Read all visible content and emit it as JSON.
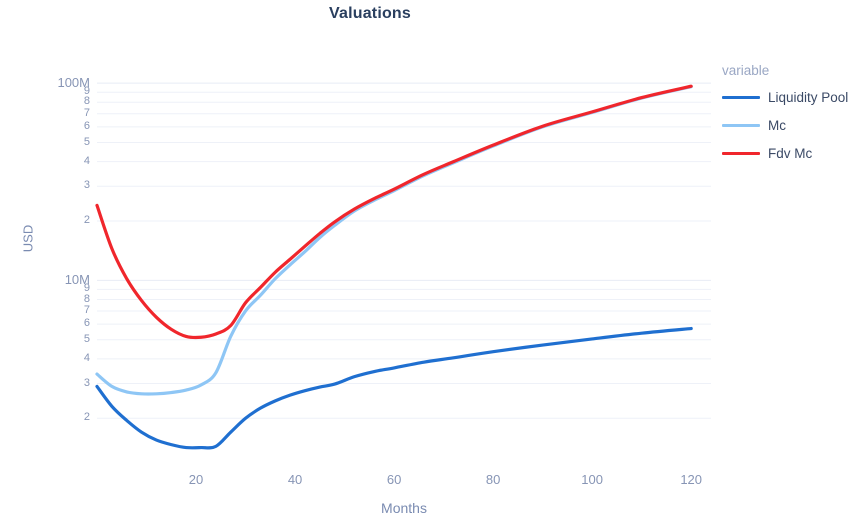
{
  "chart_data": {
    "type": "line",
    "title": "Valuations",
    "xlabel": "Months",
    "ylabel": "USD",
    "legend_title": "variable",
    "legend_position": "right",
    "grid": true,
    "yscale": "log",
    "ylim": [
      1200000,
      110000000
    ],
    "xlim": [
      0,
      124
    ],
    "xticks": [
      20,
      40,
      60,
      80,
      100,
      120
    ],
    "ytick_labels": [
      "100M",
      "9",
      "8",
      "7",
      "6",
      "5",
      "4",
      "3",
      "2",
      "10M",
      "9",
      "8",
      "7",
      "6",
      "5",
      "4",
      "3",
      "2"
    ],
    "ytick_values": [
      100000000,
      90000000,
      80000000,
      70000000,
      60000000,
      50000000,
      40000000,
      30000000,
      20000000,
      10000000,
      9000000,
      8000000,
      7000000,
      6000000,
      5000000,
      4000000,
      3000000,
      2000000
    ],
    "ytick_major": [
      "100M",
      "10M"
    ],
    "colors": {
      "liquidity_pool": "#1f6fd0",
      "mc": "#8ec6f5",
      "fdv_mc": "#f0262c",
      "grid": "#e8ecf5",
      "title": "#2a3f5f",
      "axis_text": "#8795b5"
    },
    "x": [
      0,
      3,
      6,
      9,
      12,
      15,
      18,
      21,
      24,
      27,
      30,
      33,
      36,
      39,
      42,
      45,
      48,
      52,
      56,
      60,
      66,
      72,
      80,
      90,
      100,
      110,
      120
    ],
    "series": [
      {
        "name": "Liquidity Pool",
        "color": "#1f6fd0",
        "values": [
          2900000,
          2300000,
          1950000,
          1700000,
          1550000,
          1470000,
          1420000,
          1420000,
          1440000,
          1700000,
          2000000,
          2250000,
          2450000,
          2620000,
          2760000,
          2880000,
          2980000,
          3250000,
          3450000,
          3600000,
          3850000,
          4050000,
          4350000,
          4700000,
          5050000,
          5400000,
          5700000
        ]
      },
      {
        "name": "Mc",
        "color": "#8ec6f5",
        "values": [
          3350000,
          2900000,
          2720000,
          2660000,
          2660000,
          2700000,
          2780000,
          2950000,
          3400000,
          5200000,
          7000000,
          8400000,
          10200000,
          12000000,
          14000000,
          16500000,
          19000000,
          22500000,
          25500000,
          28500000,
          34000000,
          39500000,
          48000000,
          60000000,
          71000000,
          84000000,
          96000000
        ]
      },
      {
        "name": "Fdv Mc",
        "color": "#f0262c",
        "values": [
          24000000,
          14500000,
          10200000,
          7900000,
          6500000,
          5650000,
          5200000,
          5150000,
          5350000,
          5900000,
          7700000,
          9200000,
          11000000,
          12800000,
          14900000,
          17300000,
          19800000,
          23000000,
          26000000,
          29000000,
          34500000,
          40000000,
          48500000,
          60500000,
          71500000,
          84500000,
          96500000
        ]
      }
    ]
  },
  "legend": {
    "title": "variable",
    "items": [
      {
        "label": "Liquidity Pool",
        "color": "#1f6fd0"
      },
      {
        "label": "Mc",
        "color": "#8ec6f5"
      },
      {
        "label": "Fdv Mc",
        "color": "#f0262c"
      }
    ]
  },
  "axes": {
    "x_title": "Months",
    "y_title": "USD"
  }
}
